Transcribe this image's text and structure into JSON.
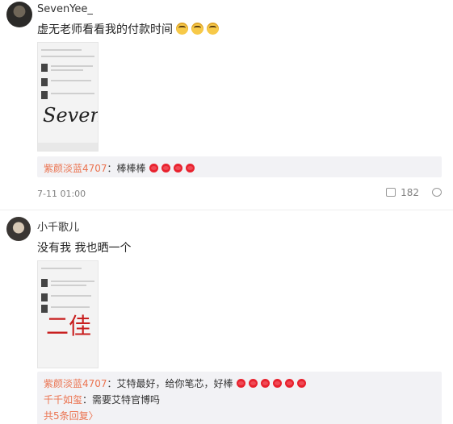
{
  "comments": [
    {
      "username": "SevenYee_",
      "text": "虚无老师看看我的付款时间",
      "emoji_icon": "doge-emoji-icon",
      "emoji_count": 3,
      "image_handwriting": "Seven",
      "reply": {
        "name": "紫颜淡蓝4707",
        "text": "：棒棒棒",
        "heart_count": 4
      },
      "timestamp": "7-11 01:00",
      "likes": "182"
    },
    {
      "username": "小千歌儿",
      "text": "没有我 我也晒一个",
      "image_handwriting": "二佳",
      "replies": [
        {
          "name": "紫颜淡蓝4707",
          "text": "：艾特最好，给你笔芯，好棒",
          "heart_count": 6
        },
        {
          "name": "千千如玺",
          "text": "：需要艾特官博吗"
        }
      ],
      "more_replies": "共5条回复〉"
    }
  ],
  "colors": {
    "name_orange": "#eb7350",
    "heart_red": "#e8222e",
    "reply_bg": "#f2f2f5"
  }
}
